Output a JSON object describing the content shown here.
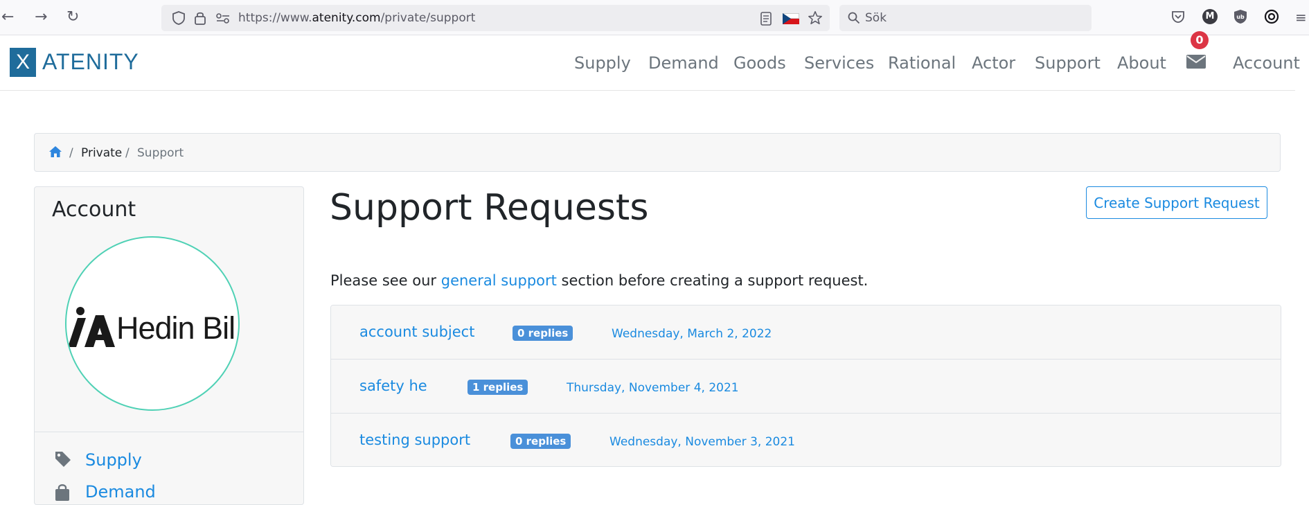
{
  "browser": {
    "url_prefix": "https://www.",
    "url_host": "atenity.com",
    "url_path": "/private/support",
    "search_placeholder": "Sök",
    "ext_m_label": "M"
  },
  "nav": {
    "brand_mark": "X",
    "brand": "ATENITY",
    "items": [
      "Supply",
      "Demand",
      "Goods",
      "Services",
      "Rational",
      "Actor",
      "Support",
      "About"
    ],
    "mail_count": "0",
    "account": "Account"
  },
  "breadcrumb": {
    "sep": "/",
    "items": [
      "Private",
      "Support"
    ]
  },
  "sidebar": {
    "title": "Account",
    "avatar_text": "Hedin Bil",
    "items": [
      {
        "label": "Supply",
        "icon": "tag-icon"
      },
      {
        "label": "Demand",
        "icon": "shopping-bag-icon"
      }
    ]
  },
  "main": {
    "title": "Support Requests",
    "create_button": "Create Support Request",
    "intro_before": "Please see our ",
    "intro_link": "general support",
    "intro_after": " section before creating a support request.",
    "requests": [
      {
        "subject": "account subject",
        "replies": "0 replies",
        "date": "Wednesday, March 2, 2022"
      },
      {
        "subject": "safety he",
        "replies": "1 replies",
        "date": "Thursday, November 4, 2021"
      },
      {
        "subject": "testing support",
        "replies": "0 replies",
        "date": "Wednesday, November 3, 2021"
      }
    ]
  },
  "colors": {
    "brand": "#1f6c9b",
    "link": "#1a8ae0",
    "badge": "#4a90d9",
    "danger": "#dc3545",
    "avatar_ring": "#4fd1b5"
  }
}
